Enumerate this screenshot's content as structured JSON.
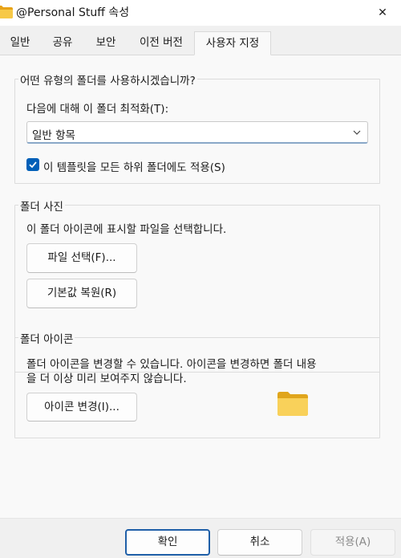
{
  "window": {
    "title": "@Personal Stuff 속성",
    "close_glyph": "✕"
  },
  "tabs": [
    {
      "label": "일반"
    },
    {
      "label": "공유"
    },
    {
      "label": "보안"
    },
    {
      "label": "이전 버전"
    },
    {
      "label": "사용자 지정",
      "active": true
    }
  ],
  "optimize_group": {
    "title": "어떤 유형의 폴더를 사용하시겠습니까?",
    "optimize_label": "다음에 대해 이 폴더 최적화(T):",
    "optimize_value": "일반 항목",
    "apply_subfolders_label": "이 템플릿을 모든 하위 폴더에도 적용(S)",
    "apply_subfolders_checked": true
  },
  "picture_group": {
    "title": "폴더 사진",
    "description": "이 폴더 아이콘에 표시할 파일을 선택합니다.",
    "choose_file_button": "파일 선택(F)...",
    "restore_default_button": "기본값 복원(R)"
  },
  "icon_group": {
    "title": "폴더 아이콘",
    "description_line1": "폴더 아이콘을 변경할 수 있습니다. 아이콘을 변경하면 폴더 내용",
    "description_line2": "을 더 이상  미리 보여주지 않습니다.",
    "change_icon_button": "아이콘 변경(I)..."
  },
  "footer": {
    "ok_button": "확인",
    "cancel_button": "취소",
    "apply_button": "적용(A)"
  },
  "colors": {
    "accent": "#005fb8",
    "folder": "#f7c948"
  }
}
